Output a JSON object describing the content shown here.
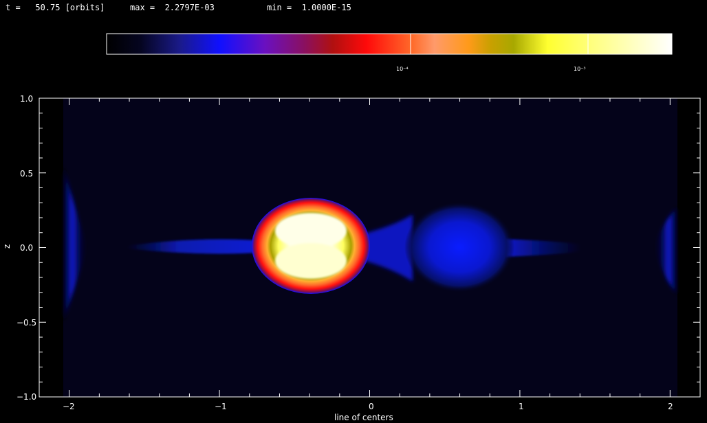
{
  "header": {
    "time_text": "t =   50.75 [orbits]",
    "max_text": "max =  2.2797E-03",
    "min_text": "min =  1.0000E-15"
  },
  "colorbar": {
    "tick_labels": [
      "10⁻⁴",
      "10⁻³"
    ],
    "tick_values": [
      0.0001,
      0.001
    ]
  },
  "plot": {
    "xlabel": "line of centers",
    "ylabel": "z",
    "x_ticks": [
      "−2",
      "−1",
      "0",
      "1",
      "2"
    ],
    "x_tick_values": [
      -2,
      -1,
      0,
      1,
      2
    ],
    "y_ticks": [
      "1.0",
      "0.5",
      "0.0",
      "−0.5",
      "−1.0"
    ],
    "y_tick_values": [
      1.0,
      0.5,
      0.0,
      -0.5,
      -1.0
    ],
    "xlim": [
      -2.2,
      2.2
    ],
    "ylim": [
      -1.0,
      1.0
    ],
    "colors": {
      "background": "#000000",
      "field": "#04031a",
      "axis": "#ffffff"
    }
  }
}
